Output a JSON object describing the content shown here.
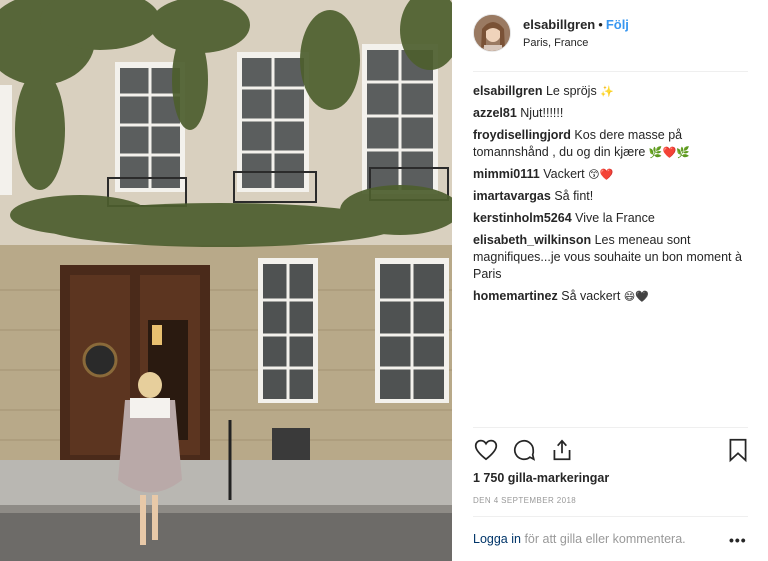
{
  "post": {
    "username": "elsabillgren",
    "separator": "•",
    "follow_label": "Följ",
    "location": "Paris, France"
  },
  "comments": [
    {
      "user": "elsabillgren",
      "text": "Le spröjs",
      "emoji": "✨"
    },
    {
      "user": "azzel81",
      "text": "Njut!!!!!!",
      "emoji": ""
    },
    {
      "user": "froydisellingjord",
      "text": "Kos dere masse på tomannshånd , du og din kjære",
      "emoji": "🌿❤️🌿"
    },
    {
      "user": "mimmi0111",
      "text": "Vackert",
      "emoji": "😙❤️"
    },
    {
      "user": "imartavargas",
      "text": "Så fint!",
      "emoji": ""
    },
    {
      "user": "kerstinholm5264",
      "text": "Vive la France",
      "emoji": ""
    },
    {
      "user": "elisabeth_wilkinson",
      "text": "Les meneau sont magnifiques...je vous souhaite un bon moment à Paris",
      "emoji": ""
    },
    {
      "user": "homemartinez",
      "text": "Så vackert",
      "emoji": "😄🖤"
    }
  ],
  "stats": {
    "likes": "1 750 gilla-markeringar",
    "date": "DEN 4 SEPTEMBER 2018"
  },
  "footer": {
    "login_link": "Logga in",
    "login_text": " för att gilla eller kommentera.",
    "more": "•••"
  },
  "icons": {
    "like": "heart-icon",
    "comment": "comment-icon",
    "share": "share-icon",
    "save": "bookmark-icon",
    "more": "more-options-icon"
  },
  "colors": {
    "follow": "#3897f0",
    "muted": "#999999",
    "text": "#262626",
    "link": "#003569"
  }
}
